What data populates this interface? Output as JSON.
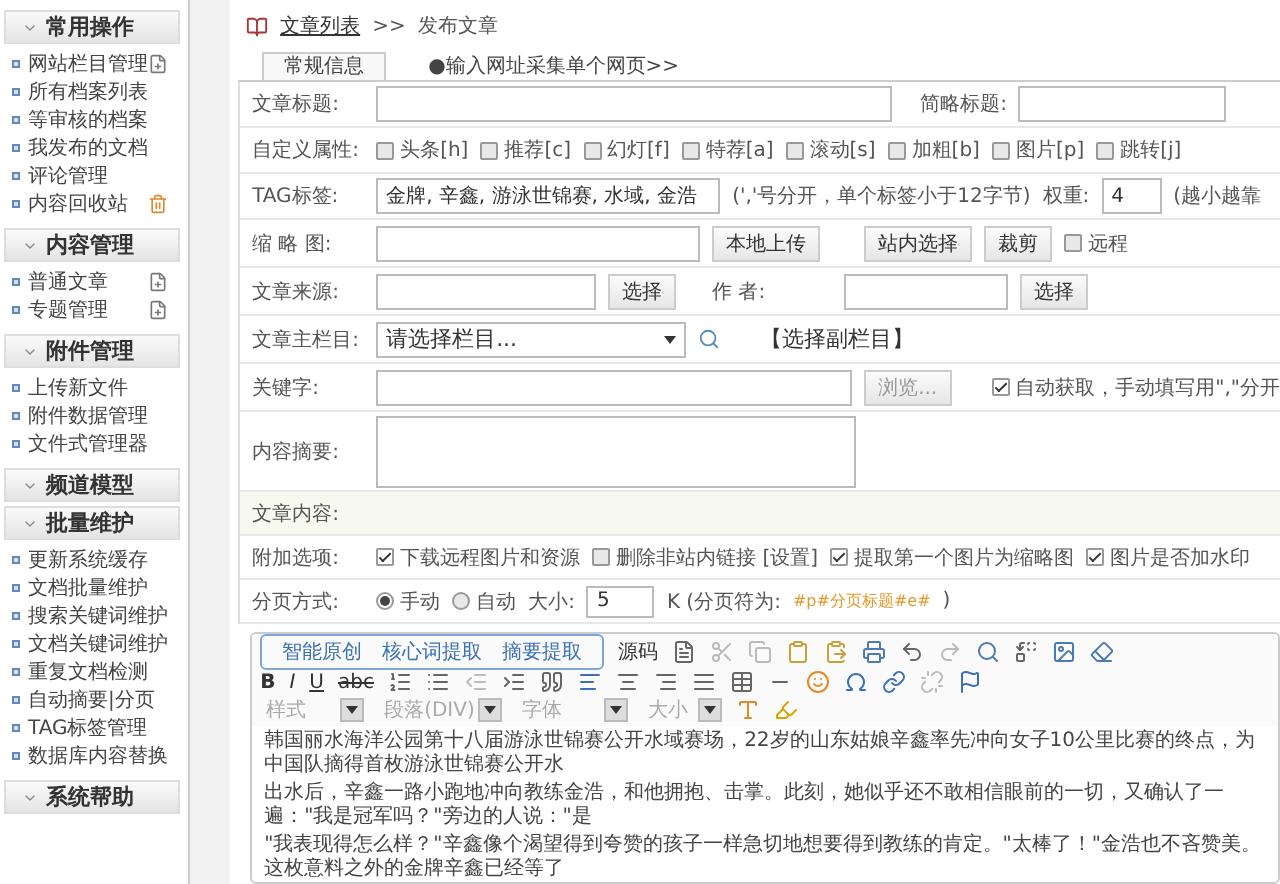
{
  "sidebar": {
    "sections": [
      {
        "title": "常用操作",
        "items": [
          {
            "label": "网站栏目管理",
            "kind": "add"
          },
          {
            "label": "所有档案列表",
            "kind": "plain"
          },
          {
            "label": "等审核的档案",
            "kind": "plain"
          },
          {
            "label": "我发布的文档",
            "kind": "plain"
          },
          {
            "label": "评论管理",
            "kind": "plain"
          },
          {
            "label": "内容回收站",
            "kind": "trash"
          }
        ]
      },
      {
        "title": "内容管理",
        "items": [
          {
            "label": "普通文章",
            "kind": "add"
          },
          {
            "label": "专题管理",
            "kind": "add"
          }
        ]
      },
      {
        "title": "附件管理",
        "items": [
          {
            "label": "上传新文件",
            "kind": "plain"
          },
          {
            "label": "附件数据管理",
            "kind": "plain"
          },
          {
            "label": "文件式管理器",
            "kind": "plain"
          }
        ]
      },
      {
        "title": "频道模型"
      },
      {
        "title": "批量维护",
        "items": [
          {
            "label": "更新系统缓存",
            "kind": "plain"
          },
          {
            "label": "文档批量维护",
            "kind": "plain"
          },
          {
            "label": "搜索关键词维护",
            "kind": "plain"
          },
          {
            "label": "文档关键词维护",
            "kind": "plain"
          },
          {
            "label": "重复文档检测",
            "kind": "plain"
          },
          {
            "label": "自动摘要|分页",
            "kind": "plain"
          },
          {
            "label": "TAG标签管理",
            "kind": "plain"
          },
          {
            "label": "数据库内容替换",
            "kind": "plain"
          }
        ]
      },
      {
        "title": "系统帮助"
      }
    ]
  },
  "breadcrumb": {
    "link": "文章列表",
    "separator": ">>",
    "current": "发布文章"
  },
  "tabs": [
    {
      "label": "常规信息",
      "selected": true
    },
    {
      "label": "●输入网址采集单个网页>>",
      "selected": false
    }
  ],
  "form": {
    "title": {
      "label": "文章标题:",
      "short_label": "简略标题:"
    },
    "attributes": {
      "label": "自定义属性:",
      "options": [
        {
          "label": "头条[h]",
          "checked": false
        },
        {
          "label": "推荐[c]",
          "checked": false
        },
        {
          "label": "幻灯[f]",
          "checked": false
        },
        {
          "label": "特荐[a]",
          "checked": false
        },
        {
          "label": "滚动[s]",
          "checked": false
        },
        {
          "label": "加粗[b]",
          "checked": false
        },
        {
          "label": "图片[p]",
          "checked": false
        },
        {
          "label": "跳转[j]",
          "checked": false
        }
      ]
    },
    "tags": {
      "label": "TAG标签:",
      "value": "金牌, 辛鑫, 游泳世锦赛, 水域, 金浩",
      "hint": "(','号分开，单个标签小于12字节)",
      "weight_label": "权重:",
      "weight_value": "4",
      "weight_hint": "(越小越靠"
    },
    "thumbnail": {
      "label": "缩 略 图:",
      "buttons": [
        "本地上传",
        "站内选择",
        "裁剪"
      ],
      "remote": {
        "label": "远程",
        "checked": false
      }
    },
    "source": {
      "label": "文章来源:",
      "button": "选择",
      "author_label": "作 者:",
      "author_button": "选择"
    },
    "column": {
      "label": "文章主栏目:",
      "value": "请选择栏目...",
      "link": "【选择副栏目】"
    },
    "keywords": {
      "label": "关键字:",
      "button": "浏览...",
      "auto": {
        "label": "自动获取，手动填写用\",\"分开",
        "checked": true
      }
    },
    "summary": {
      "label": "内容摘要:"
    },
    "content_header": "文章内容:",
    "options": {
      "label": "附加选项:",
      "items": [
        {
          "label": "下载远程图片和资源",
          "checked": true
        },
        {
          "label": "删除非站内链接 [设置]",
          "checked": false
        },
        {
          "label": "提取第一个图片为缩略图",
          "checked": true
        },
        {
          "label": "图片是否加水印",
          "checked": true
        }
      ]
    },
    "paging": {
      "label": "分页方式:",
      "modes": [
        {
          "label": "手动",
          "selected": true
        },
        {
          "label": "自动",
          "selected": false
        }
      ],
      "size_label": "大小:",
      "size_value": "5",
      "unit_note": "K (分页符为:",
      "separator_code": "#p#分页标题#e#",
      "close": ")"
    }
  },
  "editor": {
    "plugin_tabs": [
      "智能原创",
      "核心词提取",
      "摘要提取"
    ],
    "source_button": "源码",
    "format_buttons": [
      "B",
      "I",
      "U",
      "abc"
    ],
    "selects": [
      "样式",
      "段落(DIV)",
      "字体",
      "大小"
    ],
    "paragraphs": [
      "韩国丽水海洋公园第十八届游泳世锦赛公开水域赛场，22岁的山东姑娘辛鑫率先冲向女子10公里比赛的终点，为中国队摘得首枚游泳世锦赛公开水",
      "出水后，辛鑫一路小跑地冲向教练金浩，和他拥抱、击掌。此刻，她似乎还不敢相信眼前的一切，又确认了一遍：\"我是冠军吗？\"旁边的人说：\"是",
      "\"我表现得怎么样？\"辛鑫像个渴望得到夸赞的孩子一样急切地想要得到教练的肯定。\"太棒了！\"金浩也不吝赞美。这枚意料之外的金牌辛鑫已经等了"
    ]
  }
}
